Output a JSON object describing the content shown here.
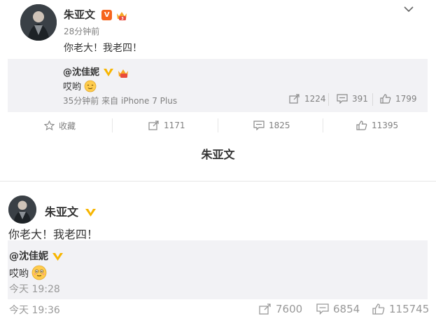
{
  "post": {
    "author": "朱亚文",
    "time": "28分钟前",
    "text": "你老大！我老四！",
    "repost": {
      "author": "@沈佳妮",
      "text": "哎哟",
      "time_source": "35分钟前 来自 iPhone 7 Plus",
      "reposts": "1224",
      "comments": "391",
      "likes": "1799"
    },
    "actions": {
      "favorite": "收藏",
      "reposts": "1171",
      "comments": "1825",
      "likes": "11395"
    }
  },
  "caption_name": "朱亚文",
  "mobile_post": {
    "author": "朱亚文",
    "text": "你老大！我老四！",
    "repost": {
      "author": "@沈佳妮",
      "text": "哎哟",
      "time": "今天 19:28"
    },
    "time": "今天 19:36",
    "reposts": "7600",
    "comments": "6854",
    "likes": "115745"
  },
  "colors": {
    "verified_orange": "#f6641c",
    "verified_yellow": "#f7b500",
    "quote_bg": "#f2f2f5",
    "muted_text": "#808080"
  },
  "icons": [
    "chevron-down-icon",
    "star-icon",
    "repost-icon",
    "comment-icon",
    "like-icon",
    "verified-icon",
    "crown-icon",
    "smile-emoji-icon"
  ]
}
